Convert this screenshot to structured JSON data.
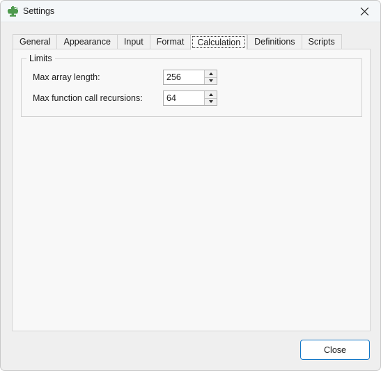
{
  "window": {
    "title": "Settings",
    "icon": "cactus-icon",
    "close_icon": "close-icon",
    "accent_color": "#1277c8",
    "titlebar_color": "#f4f7f9",
    "body_color": "#efefef",
    "panel_color": "#f8f8f8"
  },
  "tabs": {
    "selected": "Calculation",
    "items": [
      {
        "label": "General"
      },
      {
        "label": "Appearance"
      },
      {
        "label": "Input"
      },
      {
        "label": "Format"
      },
      {
        "label": "Calculation"
      },
      {
        "label": "Definitions"
      },
      {
        "label": "Scripts"
      }
    ]
  },
  "calculation": {
    "group": {
      "legend": "Limits",
      "fields": [
        {
          "label": "Max array length:",
          "value": "256",
          "up_icon": "arrow-up-icon",
          "down_icon": "arrow-down-icon"
        },
        {
          "label": "Max function call recursions:",
          "value": "64",
          "up_icon": "arrow-up-icon",
          "down_icon": "arrow-down-icon"
        }
      ]
    }
  },
  "footer": {
    "close_label": "Close"
  }
}
